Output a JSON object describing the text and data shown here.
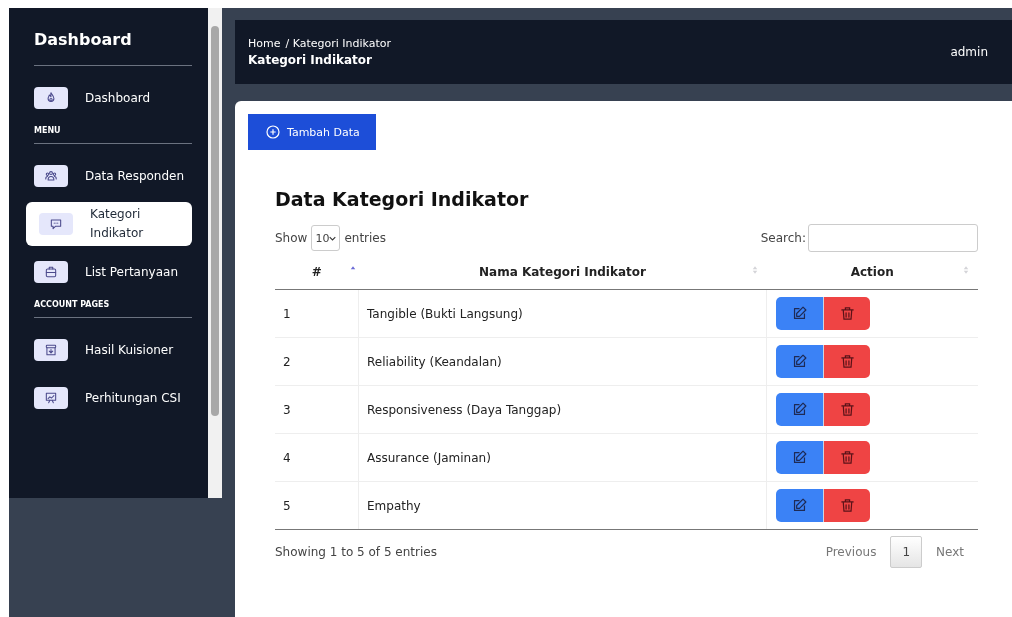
{
  "sidebar": {
    "title": "Dashboard",
    "items": [
      {
        "kind": "item",
        "label": "Dashboard",
        "selected": false
      },
      {
        "kind": "heading",
        "label": "MENU"
      },
      {
        "kind": "item",
        "label": "Data Responden",
        "selected": false
      },
      {
        "kind": "item",
        "label": "Kategori Indikator",
        "selected": true
      },
      {
        "kind": "item",
        "label": "List Pertanyaan",
        "selected": false
      },
      {
        "kind": "heading",
        "label": "ACCOUNT PAGES"
      },
      {
        "kind": "item",
        "label": "Hasil Kuisioner",
        "selected": false
      },
      {
        "kind": "item",
        "label": "Perhitungan CSI",
        "selected": false
      }
    ]
  },
  "header": {
    "breadcrumb": [
      "Home",
      "/ Kategori Indikator"
    ],
    "page_title": "Kategori Indikator",
    "user": "admin"
  },
  "add_button": "Tambah Data",
  "card_title": "Data Kategori Indikator",
  "length": {
    "before": "Show",
    "value": "10",
    "after": "entries"
  },
  "search": {
    "label": "Search:"
  },
  "table": {
    "columns": [
      {
        "label": "#",
        "sorted": true
      },
      {
        "label": "Nama Kategori Indikator",
        "sorted": false
      },
      {
        "label": "Action",
        "sorted": false
      }
    ],
    "rows": [
      {
        "no": "1",
        "name": "Tangible (Bukti Langsung)"
      },
      {
        "no": "2",
        "name": "Reliability (Keandalan)"
      },
      {
        "no": "3",
        "name": "Responsiveness (Daya Tanggap)"
      },
      {
        "no": "4",
        "name": "Assurance (Jaminan)"
      },
      {
        "no": "5",
        "name": "Empathy"
      }
    ]
  },
  "info": "Showing 1 to 5 of 5 entries",
  "pagination": {
    "previous": "Previous",
    "pages": [
      {
        "label": "1",
        "selected": true
      }
    ],
    "next": "Next"
  }
}
